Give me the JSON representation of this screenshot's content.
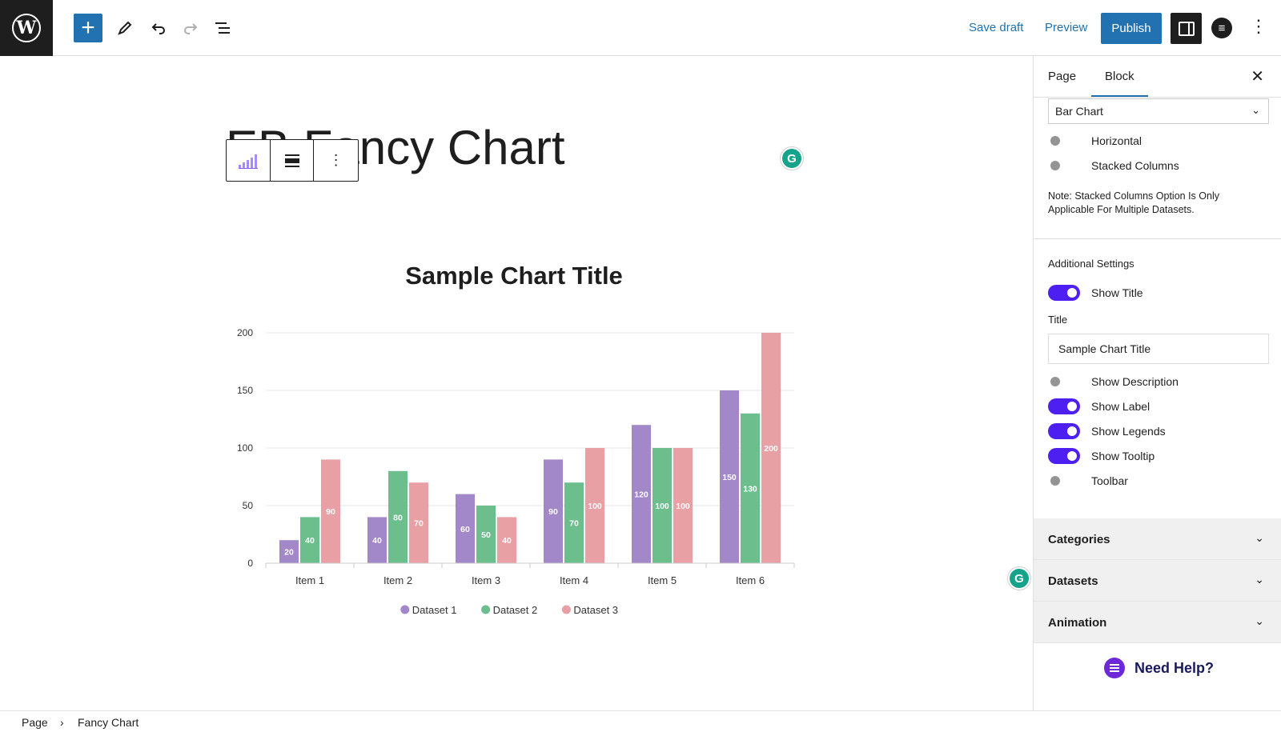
{
  "toolbar": {
    "add_label": "+",
    "save_draft": "Save draft",
    "preview": "Preview",
    "publish": "Publish",
    "icons": [
      "wordpress-logo-icon",
      "plus-icon",
      "pencil-icon",
      "undo-icon",
      "redo-icon",
      "list-view-icon",
      "settings-panel-icon",
      "plugin-icon",
      "more-vertical-icon"
    ]
  },
  "editor": {
    "post_title": "EB Fancy Chart",
    "grammarly": "G"
  },
  "chart_data": {
    "type": "bar",
    "title": "Sample Chart Title",
    "categories": [
      "Item 1",
      "Item 2",
      "Item 3",
      "Item 4",
      "Item 5",
      "Item 6"
    ],
    "series": [
      {
        "name": "Dataset 1",
        "color": "#a287c9",
        "values": [
          20,
          40,
          60,
          90,
          120,
          150
        ]
      },
      {
        "name": "Dataset 2",
        "color": "#6cbf8c",
        "values": [
          40,
          80,
          50,
          70,
          100,
          130
        ]
      },
      {
        "name": "Dataset 3",
        "color": "#e8a0a4",
        "values": [
          90,
          70,
          40,
          100,
          100,
          200
        ]
      }
    ],
    "yticks": [
      0,
      50,
      100,
      150,
      200
    ],
    "ylim": [
      0,
      200
    ],
    "grid": true,
    "legend": "bottom",
    "show_labels": true
  },
  "sidebar": {
    "tab_page": "Page",
    "tab_block": "Block",
    "chart_type": "Bar Chart",
    "horizontal": "Horizontal",
    "stacked": "Stacked Columns",
    "note": "Note: Stacked Columns Option Is Only Applicable For Multiple Datasets.",
    "additional_settings": "Additional Settings",
    "show_title": "Show Title",
    "title_label": "Title",
    "title_value": "Sample Chart Title",
    "show_description": "Show Description",
    "show_label": "Show Label",
    "show_legends": "Show Legends",
    "show_tooltip": "Show Tooltip",
    "toolbar": "Toolbar",
    "panels": [
      "Categories",
      "Datasets",
      "Animation"
    ],
    "need_help": "Need Help?"
  },
  "toggles": {
    "horizontal": false,
    "stacked": false,
    "show_title": true,
    "show_description": false,
    "show_label": true,
    "show_legends": true,
    "show_tooltip": true,
    "toolbar": false
  },
  "colors": {
    "accent": "#2271b1",
    "toggle_on": "#4d1ff0"
  },
  "footer": {
    "crumb_1": "Page",
    "separator": "›",
    "crumb_2": "Fancy Chart"
  }
}
